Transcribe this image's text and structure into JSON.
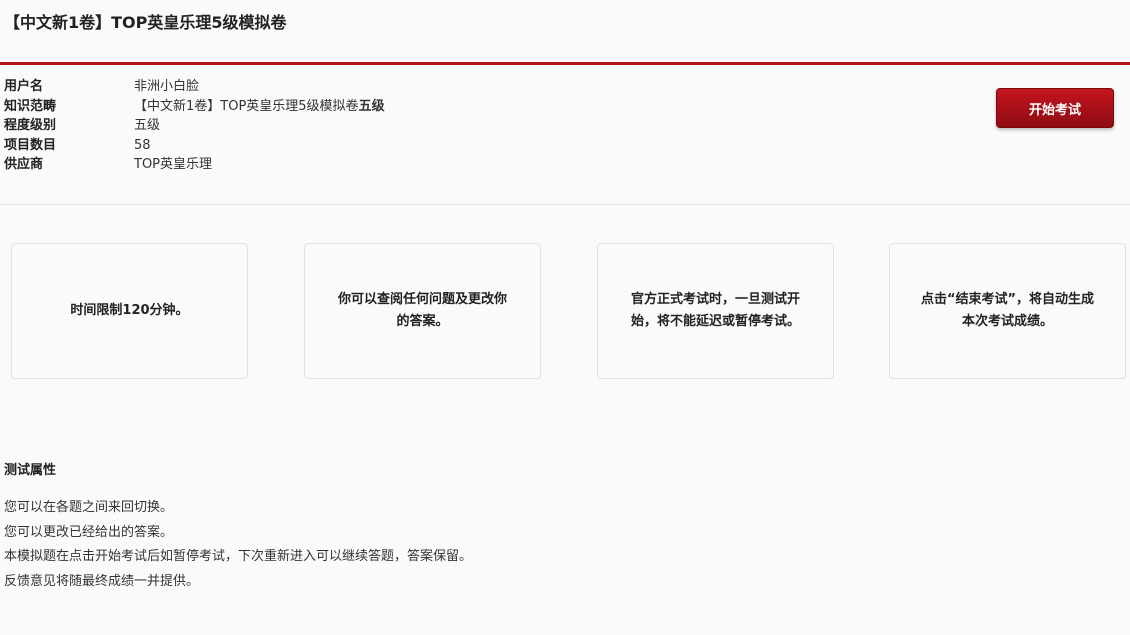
{
  "page": {
    "title": "【中文新1卷】TOP英皇乐理5级模拟卷"
  },
  "info": {
    "rows": [
      {
        "label": "用户名",
        "value": "非洲小白脸"
      },
      {
        "label": "知识范畴",
        "value": "【中文新1卷】TOP英皇乐理5级模拟卷",
        "value_bold": "五级"
      },
      {
        "label": "程度级别",
        "value": "五级"
      },
      {
        "label": "项目数目",
        "value": "58"
      },
      {
        "label": "供应商",
        "value": "TOP英皇乐理"
      }
    ]
  },
  "actions": {
    "start_label": "开始考试"
  },
  "cards": [
    "时间限制120分钟。",
    "你可以查阅任何问题及更改你的答案。",
    "官方正式考试时，一旦测试开始，将不能延迟或暂停考试。",
    "点击“结束考试”，将自动生成本次考试成绩。"
  ],
  "properties": {
    "title": "测试属性",
    "items": [
      "您可以在各题之间来回切换。",
      "您可以更改已经给出的答案。",
      "本模拟题在点击开始考试后如暂停考试，下次重新进入可以继续答题，答案保留。",
      "反馈意见将随最终成绩一并提供。"
    ]
  },
  "colors": {
    "accent": "#b3121c",
    "button": "#a8101a"
  }
}
